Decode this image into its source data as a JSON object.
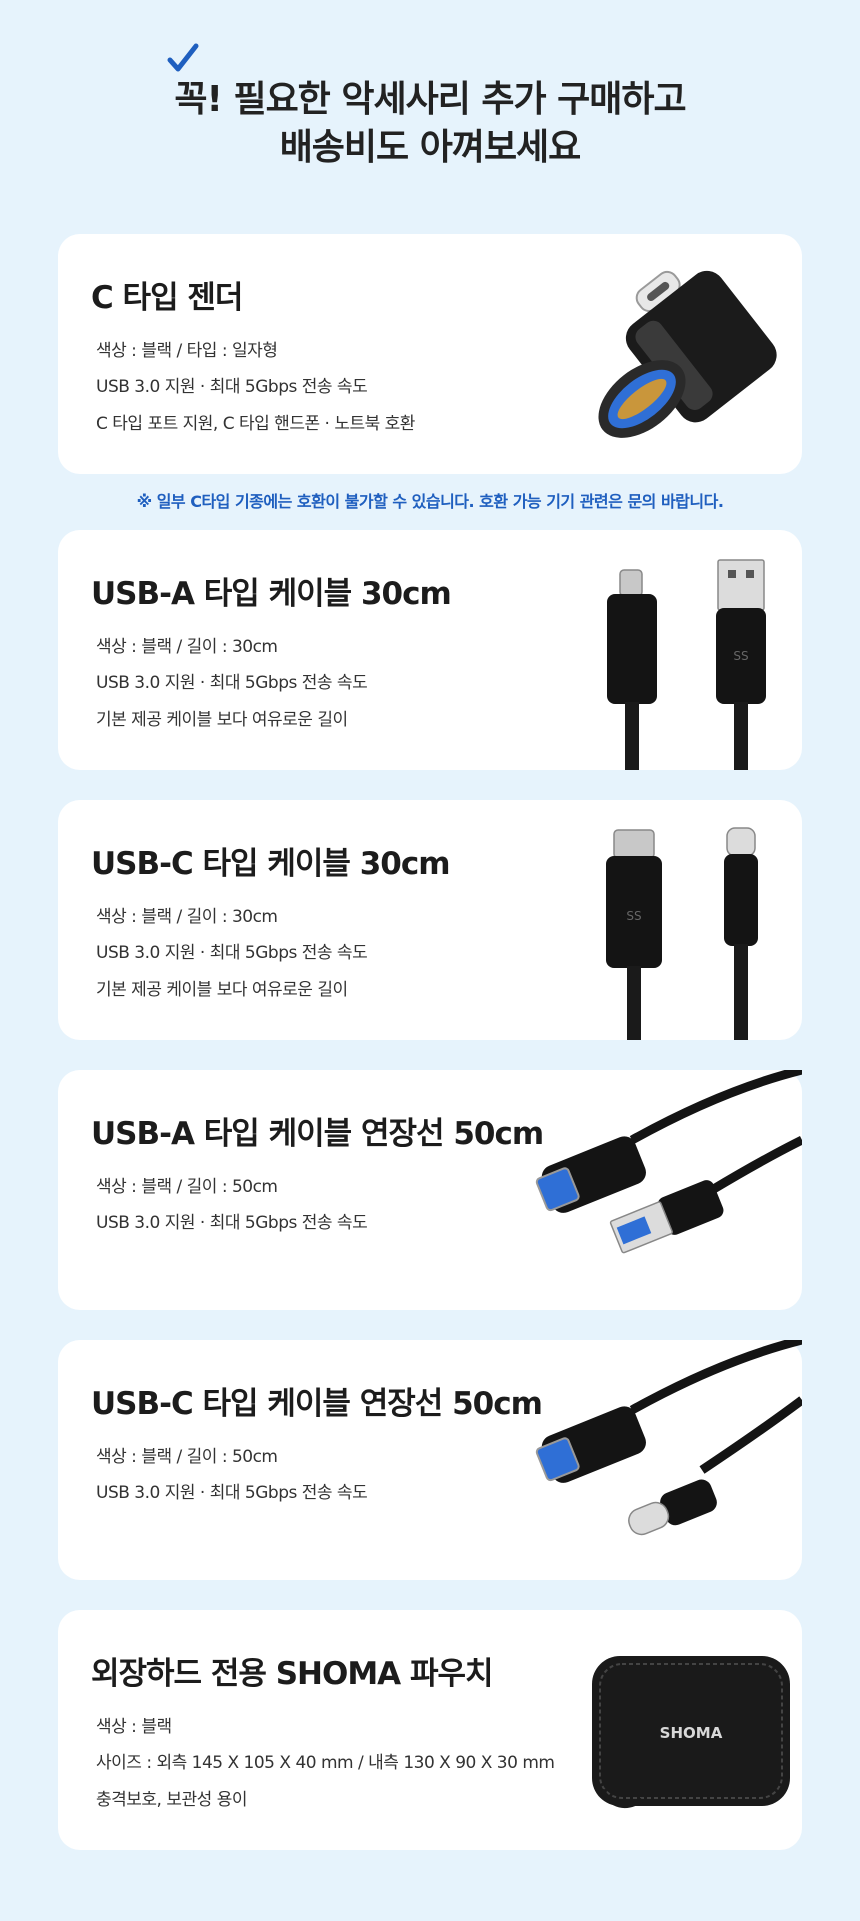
{
  "header": {
    "line1": "꼭! 필요한 악세사리 추가 구매하고",
    "line2": "배송비도 아껴보세요",
    "accent_color": "#1f5fbf"
  },
  "notice": "※ 일부 C타입 기종에는 호환이 불가할 수 있습니다. 호환 가능 기기 관련은 문의 바랍니다.",
  "products": [
    {
      "title": "C 타입 젠더",
      "specs": [
        "색상 : 블랙 / 타입 : 일자형",
        "USB 3.0 지원 · 최대 5Gbps 전송 속도",
        "C 타입 포트 지원, C 타입 핸드폰 · 노트북 호환"
      ],
      "image": "usb-c-otg-adapter"
    },
    {
      "title": "USB-A 타입 케이블 30cm",
      "specs": [
        "색상 : 블랙 / 길이 : 30cm",
        "USB 3.0 지원 · 최대 5Gbps 전송 속도",
        "기본 제공 케이블 보다 여유로운 길이"
      ],
      "image": "usb-a-cable"
    },
    {
      "title": "USB-C 타입 케이블 30cm",
      "specs": [
        "색상 : 블랙 / 길이 : 30cm",
        "USB 3.0 지원 · 최대 5Gbps 전송 속도",
        "기본 제공 케이블 보다 여유로운 길이"
      ],
      "image": "usb-c-cable"
    },
    {
      "title": "USB-A 타입 케이블 연장선 50cm",
      "specs": [
        "색상 : 블랙 / 길이 : 50cm",
        "USB 3.0 지원 · 최대 5Gbps 전송 속도"
      ],
      "image": "usb-a-extension"
    },
    {
      "title": "USB-C 타입 케이블 연장선 50cm",
      "specs": [
        "색상 : 블랙 / 길이 : 50cm",
        "USB 3.0 지원 · 최대 5Gbps 전송 속도"
      ],
      "image": "usb-c-extension"
    },
    {
      "title": "외장하드 전용 SHOMA 파우치",
      "specs": [
        "색상 : 블랙",
        "사이즈 : 외측 145 X 105 X 40 mm / 내측 130 X 90 X 30 mm",
        "충격보호, 보관성 용이"
      ],
      "image": "shoma-pouch",
      "pouch_label": "SHOMA"
    }
  ]
}
